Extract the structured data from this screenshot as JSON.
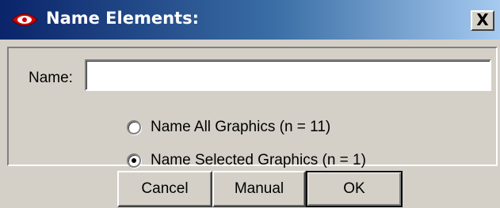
{
  "window": {
    "title": "Name Elements:",
    "icon": "red-eye-icon",
    "close_label": "X"
  },
  "form": {
    "name_label": "Name:",
    "name_value": "",
    "radio_all_label": "Name All Graphics (n = 11)",
    "radio_all_checked": false,
    "radio_selected_label": "Name Selected Graphics (n = 1)",
    "radio_selected_checked": true
  },
  "buttons": {
    "cancel": "Cancel",
    "manual": "Manual",
    "ok": "OK"
  },
  "colors": {
    "titlebar_start": "#0a246a",
    "titlebar_end": "#a6caf0",
    "dialog_bg": "#d4d0c8",
    "icon_red": "#d40000"
  }
}
